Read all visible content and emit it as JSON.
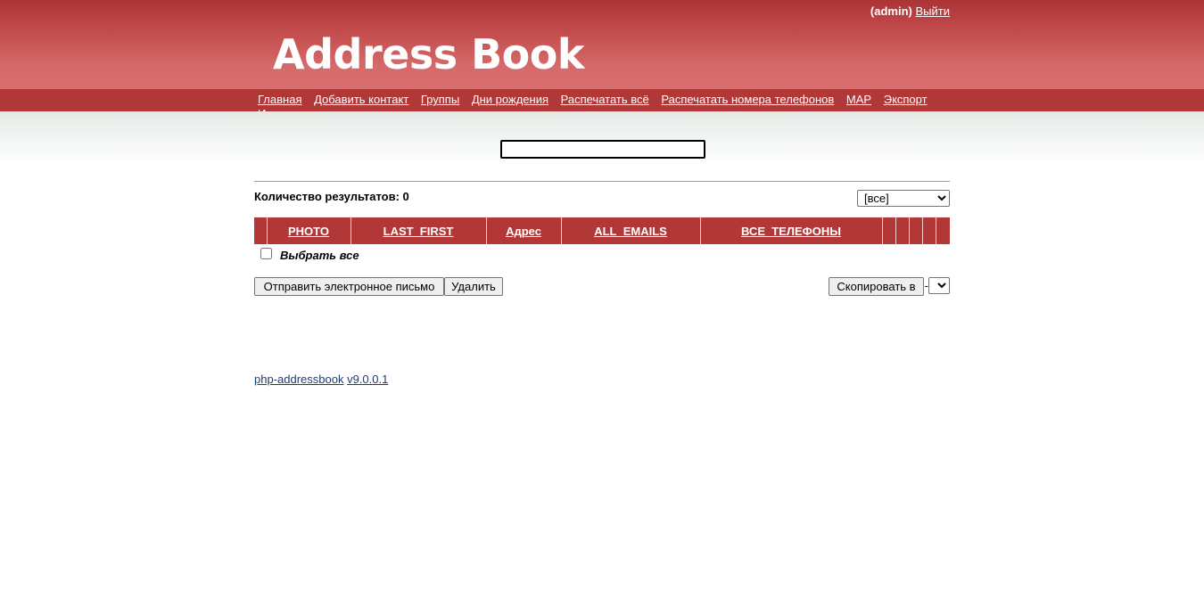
{
  "header": {
    "username": "(admin)",
    "logout_label": "Выйти",
    "logo_text": "Address Book"
  },
  "nav": {
    "items": [
      {
        "label": "Главная"
      },
      {
        "label": "Добавить контакт"
      },
      {
        "label": "Группы"
      },
      {
        "label": "Дни рождения"
      },
      {
        "label": "Распечатать всё"
      },
      {
        "label": "Распечатать номера телефонов"
      },
      {
        "label": "MAP"
      },
      {
        "label": "Экспорт"
      },
      {
        "label": "Импорт"
      }
    ]
  },
  "search": {
    "value": "",
    "placeholder": ""
  },
  "results": {
    "count_label": "Количество результатов: 0",
    "group_filter_selected": "[все]"
  },
  "table": {
    "columns": [
      {
        "label": ""
      },
      {
        "label": "PHOTO"
      },
      {
        "label": "LAST_FIRST"
      },
      {
        "label": "Адрес"
      },
      {
        "label": "ALL_EMAILS"
      },
      {
        "label": "ВСЕ_ТЕЛЕФОНЫ"
      },
      {
        "label": ""
      },
      {
        "label": ""
      },
      {
        "label": ""
      },
      {
        "label": ""
      },
      {
        "label": ""
      }
    ]
  },
  "select_all_label": "Выбрать все",
  "actions": {
    "email_label": "Отправить электронное письмо",
    "delete_label": "Удалить",
    "copy_label": "Скопировать в",
    "copy_separator": "-"
  },
  "footer": {
    "app_link": "php-addressbook",
    "version_link": "v9.0.0.1"
  },
  "colors": {
    "header_red": "#b23838",
    "link_blue": "#1b3e6e"
  }
}
